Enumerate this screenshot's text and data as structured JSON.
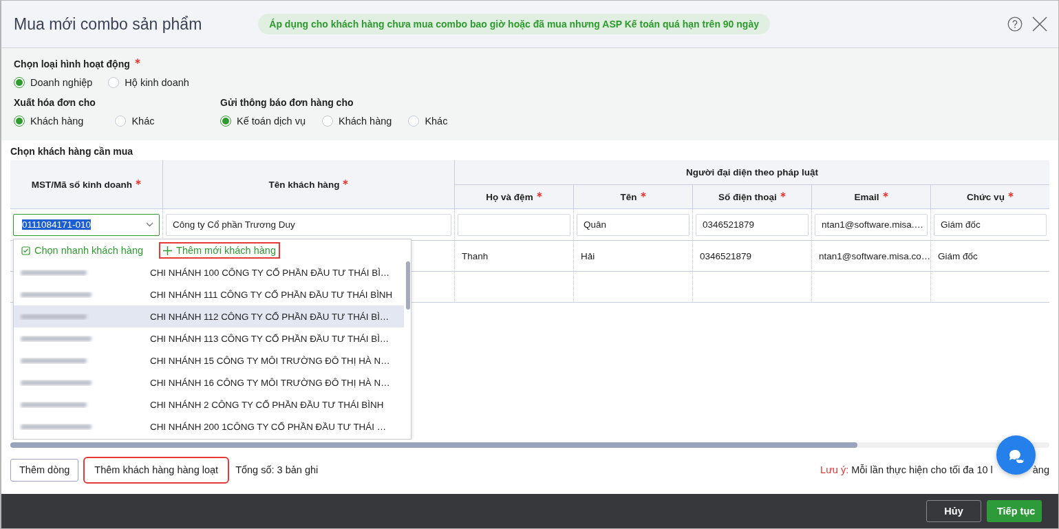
{
  "dialog": {
    "title": "Mua mới combo sản phẩm",
    "notice": "Áp dụng cho khách hàng chưa mua combo bao giờ hoặc đã mua nhưng ASP Kế toán quá hạn trên 90 ngày"
  },
  "activity_type": {
    "label": "Chọn loại hình hoạt động",
    "required": true,
    "options": [
      {
        "label": "Doanh nghiệp",
        "selected": true
      },
      {
        "label": "Hộ kinh doanh",
        "selected": false
      }
    ]
  },
  "invoice_for": {
    "label": "Xuất hóa đơn cho",
    "options": [
      {
        "label": "Khách hàng",
        "selected": true
      },
      {
        "label": "Khác",
        "selected": false
      }
    ]
  },
  "notify_for": {
    "label": "Gửi thông báo đơn hàng cho",
    "options": [
      {
        "label": "Kế toán dịch vụ",
        "selected": true
      },
      {
        "label": "Khách hàng",
        "selected": false
      },
      {
        "label": "Khác",
        "selected": false
      }
    ]
  },
  "customer_section": {
    "title": "Chọn khách hàng cần mua"
  },
  "table": {
    "group_header": "Người đại diện theo pháp luật",
    "columns": [
      {
        "label": "MST/Mã số kinh doanh",
        "required": true
      },
      {
        "label": "Tên khách hàng",
        "required": true
      },
      {
        "label": "Họ và đệm",
        "required": true
      },
      {
        "label": "Tên",
        "required": true
      },
      {
        "label": "Số điện thoại",
        "required": true
      },
      {
        "label": "Email",
        "required": true
      },
      {
        "label": "Chức vụ",
        "required": true
      }
    ],
    "rows": [
      {
        "kind": "editing",
        "cells": [
          "0111084171-010",
          "Công ty Cổ phần Trương Duy",
          null,
          "Quân",
          "0346521879",
          "ntan1@software.misa.…",
          "Giám đốc"
        ]
      },
      {
        "kind": "plain",
        "cells": [
          null,
          null,
          "Thanh",
          "Hải",
          "0346521879",
          "ntan1@software.misa.co…",
          "Giám đốc"
        ]
      },
      {
        "kind": "empty"
      }
    ]
  },
  "dropdown": {
    "quick_pick": "Chọn nhanh khách hàng",
    "add_new": {
      "label": "Thêm mới khách hàng",
      "highlighted": true
    },
    "items": [
      {
        "name": "CHI NHÁNH 100 CÔNG TY CỔ PHẦN ĐẦU TƯ THÁI BÌ…",
        "selected": false
      },
      {
        "name": "CHI NHÁNH 111 CÔNG TY CỔ PHẦN ĐẦU TƯ THÁI BÌNH",
        "selected": false
      },
      {
        "name": "CHI NHÁNH 112 CÔNG TY CỔ PHẦN ĐẦU TƯ THÁI BÌ…",
        "selected": true
      },
      {
        "name": "CHI NHÁNH 113 CÔNG TY CỔ PHẦN ĐẦU TƯ THÁI BÌ…",
        "selected": false
      },
      {
        "name": "CHI NHÁNH 15 CÔNG TY MÔI TRƯỜNG ĐÔ THỊ HÀ N…",
        "selected": false
      },
      {
        "name": "CHI NHÁNH 16 CÔNG TY MÔI TRƯỜNG ĐÔ THỊ HÀ N…",
        "selected": false
      },
      {
        "name": "CHI NHÁNH 2 CÔNG TY CỔ PHẦN ĐẦU TƯ THÁI BÌNH",
        "selected": false
      },
      {
        "name": "CHI NHÁNH 200 1CÔNG TY CỔ PHẦN ĐẦU TƯ THÁI …",
        "selected": false
      }
    ]
  },
  "bottom": {
    "buttons": [
      {
        "label": "Thêm dòng",
        "highlighted": false
      },
      {
        "label": "Thêm khách hàng hàng loạt",
        "highlighted": true
      }
    ],
    "total": "Tổng số: 3 bản ghi",
    "note_label": "Lưu ý:",
    "note_text": "Mỗi lần thực hiện cho tối đa 10 l",
    "note_tail": "àng"
  },
  "footer": {
    "cancel": "Hủy",
    "continue": "Tiếp tục"
  }
}
